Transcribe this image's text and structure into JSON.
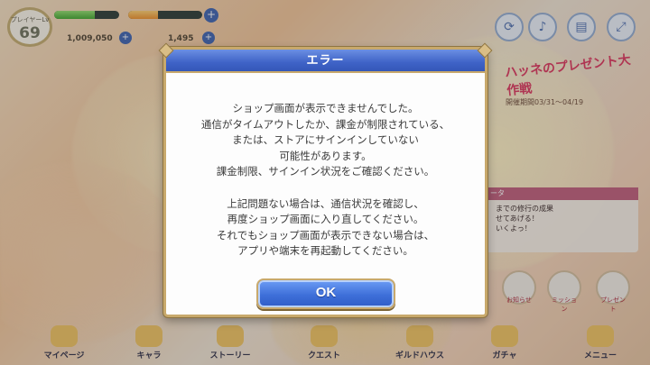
{
  "hud": {
    "level_label": "プレイヤーLv",
    "level": "69",
    "mana": "1,009,050",
    "jewels": "1,495",
    "plus": "+"
  },
  "event": {
    "title": "ハッネのプレゼント大作戦",
    "period": "開催期間03/31～04/19"
  },
  "notice": {
    "header": "ータ",
    "line1": "までの修行の成果",
    "line2": "せてあげる！",
    "line3": "いくよっ！"
  },
  "side_items": [
    "お知らせ",
    "ミッション",
    "プレゼント"
  ],
  "bottom_nav": [
    "マイページ",
    "キャラ",
    "ストーリー",
    "クエスト",
    "ギルドハウス",
    "ガチャ",
    "メニュー"
  ],
  "dialog": {
    "title": "エラー",
    "lines_a": [
      "ショップ画面が表示できませんでした。",
      "通信がタイムアウトしたか、課金が制限されている、",
      "または、ストアにサインインしていない",
      "可能性があります。",
      "課金制限、サインイン状況をご確認ください。"
    ],
    "lines_b": [
      "上記問題ない場合は、通信状況を確認し、",
      "再度ショップ画面に入り直してください。",
      "それでもショップ画面が表示できない場合は、",
      "アプリや端末を再起動してください。"
    ],
    "ok_label": "OK"
  }
}
